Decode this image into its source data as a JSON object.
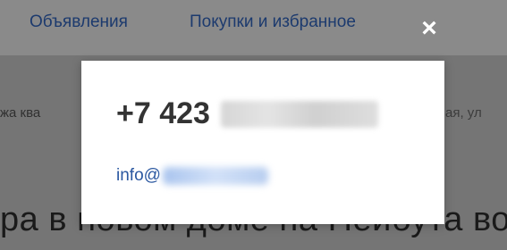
{
  "nav": {
    "ads_label": "Объявления",
    "purchases_label": "Покупки и избранное",
    "close_glyph": "×"
  },
  "background": {
    "snippet_left": "жа ква",
    "snippet_right": "ая, ул",
    "headline": "ра в новом доме на Нейбута во"
  },
  "contact_modal": {
    "phone_visible": "+7 423",
    "email_visible": "info@"
  },
  "colors": {
    "link": "#2a57a0",
    "overlay": "#757575",
    "modal_bg": "#ffffff"
  }
}
